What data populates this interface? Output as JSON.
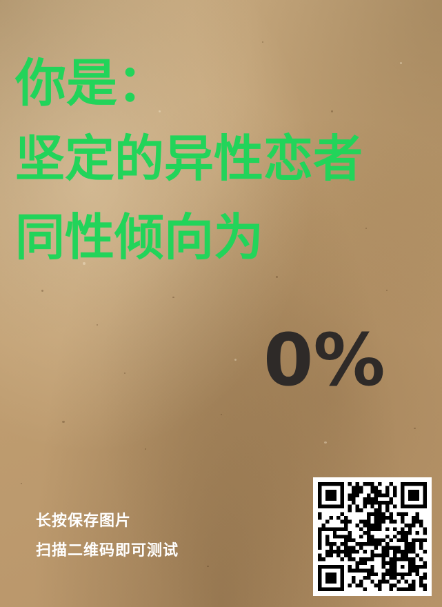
{
  "headline": {
    "line1": "你是：",
    "line2": "坚定的异性恋者",
    "line3": "同性倾向为"
  },
  "result": {
    "percentage": "0%"
  },
  "instructions": {
    "line1": "长按保存图片",
    "line2": "扫描二维码即可测试"
  },
  "colors": {
    "headline": "#22d45a",
    "percentage": "#2e2a28",
    "instructions": "#ffffff",
    "background": "#c3a276"
  }
}
